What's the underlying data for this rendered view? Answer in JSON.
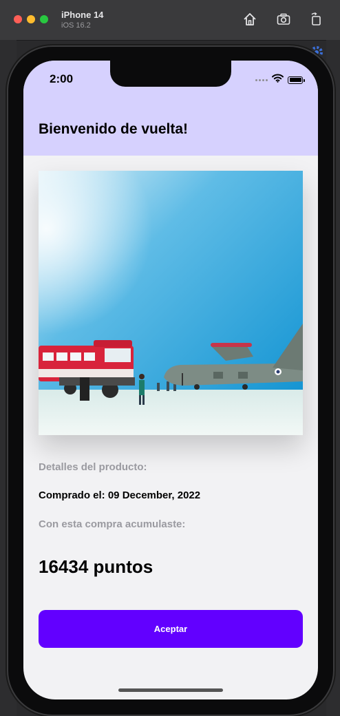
{
  "simulator": {
    "device_name": "iPhone 14",
    "os_version": "iOS 16.2",
    "icons": [
      "home-icon",
      "screenshot-icon",
      "rotate-icon"
    ]
  },
  "status_bar": {
    "time": "2:00",
    "icons": [
      "wifi-icon",
      "battery-icon"
    ]
  },
  "header": {
    "title": "Bienvenido de vuelta!"
  },
  "product": {
    "image": "snow-bus-and-military-airplane-photo",
    "details_label": "Detalles del producto:",
    "purchase_date": "Comprado el: 09 December, 2022",
    "accumulated_label": "Con esta compra acumulaste:",
    "points": "16434",
    "points_unit": "puntos"
  },
  "actions": {
    "accept_label": "Aceptar"
  },
  "colors": {
    "header_background": "#d6d1fe",
    "accent": "#6200ff",
    "screen_background": "#f2f2f4",
    "muted_text": "#9a9aa0"
  }
}
